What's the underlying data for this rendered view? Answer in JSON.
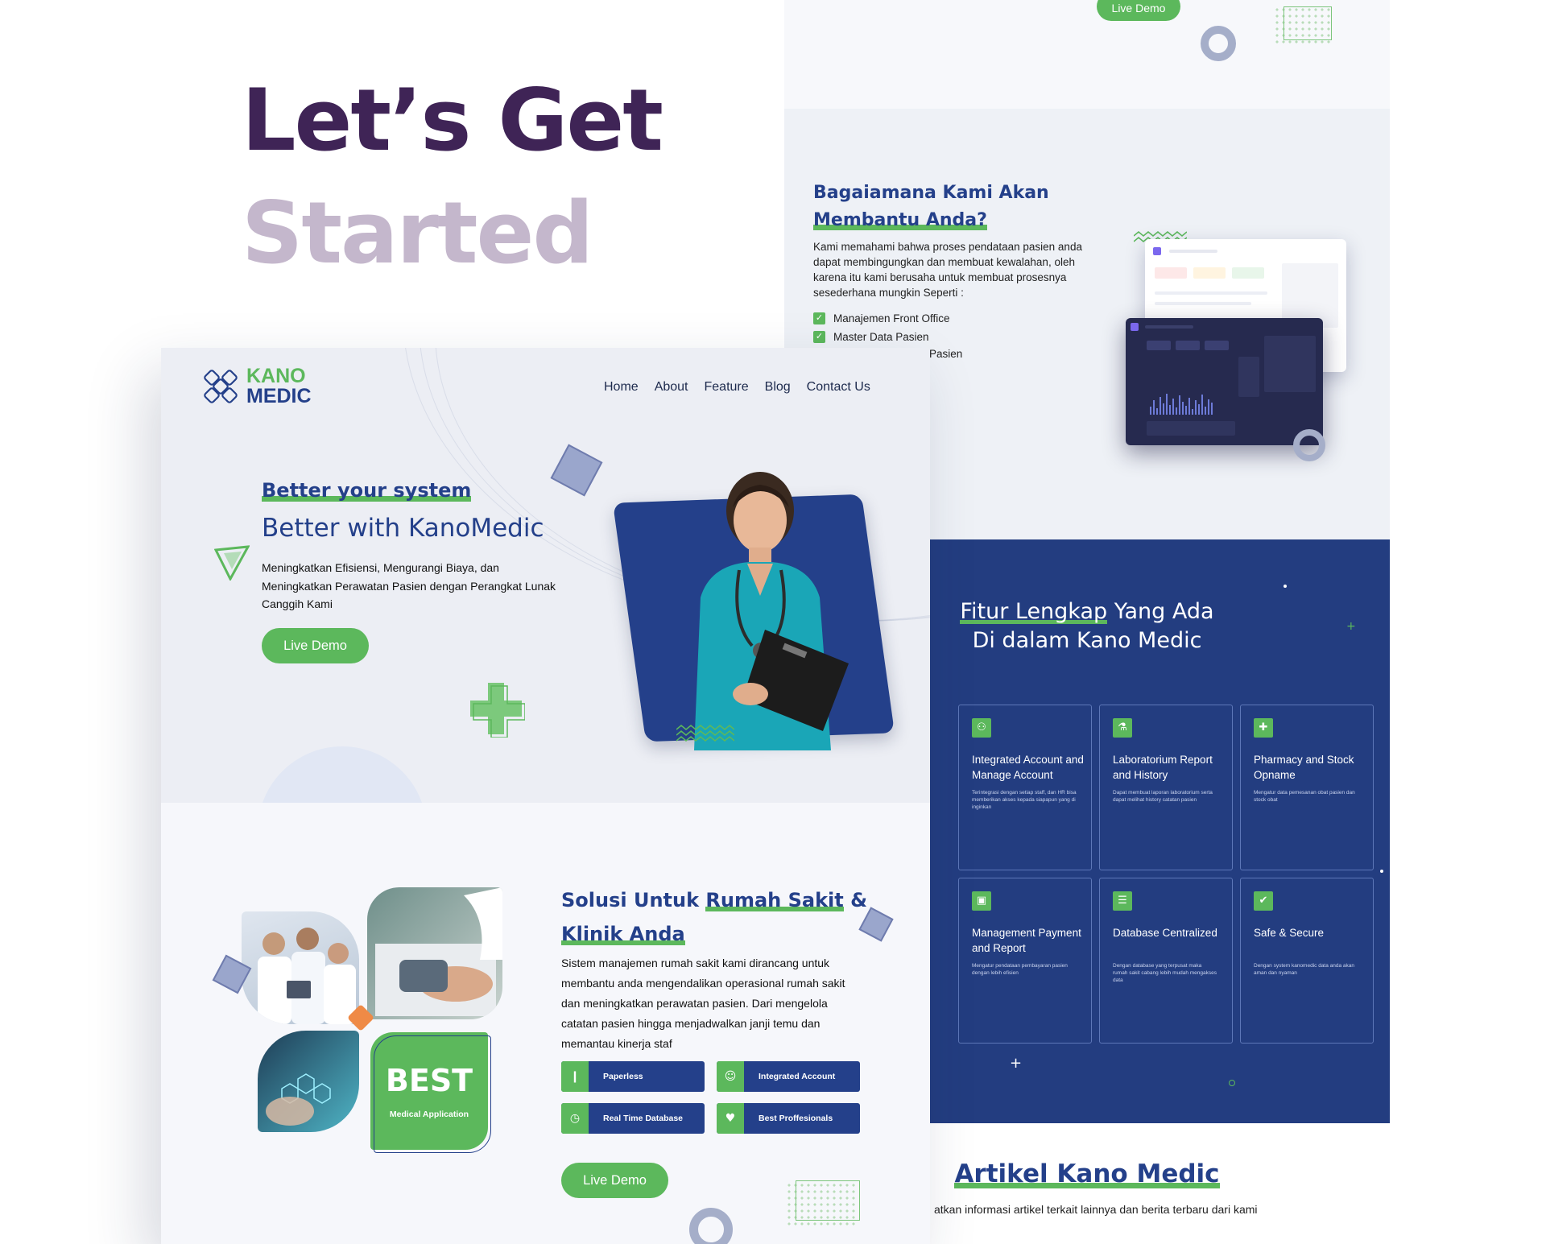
{
  "showcase": {
    "headline_line1": "Let’s Get",
    "headline_line2": "Started"
  },
  "right_page": {
    "top": {
      "live_demo_label": "Live Demo"
    },
    "how": {
      "title_line1": "Bagaiamana Kami Akan",
      "title_line2": "Membantu Anda?",
      "body": "Kami memahami bahwa proses pendataan pasien anda dapat membingungkan dan membuat kewalahan, oleh karena itu kami berusaha untuk membuat prosesnya sesederhana  mungkin Seperti :",
      "checklist": [
        "Manajemen Front Office",
        "Master Data Pasien",
        "Pasien"
      ]
    },
    "features": {
      "title_highlight": "Fitur Lengkap",
      "title_rest": " Yang Ada",
      "title_line2": "Di dalam Kano Medic",
      "cards": [
        {
          "icon": "users-network-icon",
          "glyph": "⚇",
          "title": "Integrated Account and Manage Account",
          "desc": "Terintegrasi dengan setiap staff, dan HR bisa memberikan akses kepada siapapun yang di inginkan"
        },
        {
          "icon": "flask-icon",
          "glyph": "⚗",
          "title": "Laboratorium Report and History",
          "desc": "Dapat membuat laporan laboratorium serta dapat melihat history catatan pasien"
        },
        {
          "icon": "pharmacy-icon",
          "glyph": "✚",
          "title": "Pharmacy and Stock Opname",
          "desc": "Mengatur data pemesanan obat pasien dan stock obat"
        },
        {
          "icon": "money-icon",
          "glyph": "▣",
          "title": "Management Payment and Report",
          "desc": "Mengatur pendataan pembayaran pasien dengan lebih efisien"
        },
        {
          "icon": "database-list-icon",
          "glyph": "☰",
          "title": "Database Centralized",
          "desc": "Dengan database yang terpusat maka rumah sakit cabang lebih mudah mengakses data"
        },
        {
          "icon": "shield-check-icon",
          "glyph": "✔",
          "title": "Safe & Secure",
          "desc": "Dengan system kanomedic data anda akan aman dan nyaman"
        }
      ]
    },
    "articles": {
      "title": "Artikel Kano Medic",
      "subtitle": "atkan informasi artikel terkait lainnya dan berita terbaru dari kami"
    }
  },
  "left_page": {
    "brand": {
      "line1": "KANO",
      "line2": "MEDIC"
    },
    "nav": [
      "Home",
      "About",
      "Feature",
      "Blog",
      "Contact Us"
    ],
    "hero": {
      "kicker": "Better your system",
      "title": "Better with KanoMedic",
      "description": "Meningkatkan Efisiensi, Mengurangi Biaya, dan Meningkatkan Perawatan Pasien dengan Perangkat Lunak Canggih Kami",
      "cta": "Live Demo"
    },
    "solution": {
      "title_plain": "Solusi Untuk ",
      "title_highlight": "Rumah Sakit",
      "title_amp": " &",
      "title_line2": "Klinik Anda",
      "body": "Sistem manajemen rumah sakit kami  dirancang untuk membantu anda mengendalikan operasional rumah sakit dan meningkatkan perawatan pasien. Dari mengelola catatan pasien hingga menjadwalkan janji temu dan memantau kinerja staf",
      "pills": [
        {
          "icon": "document-icon",
          "glyph": "❙",
          "label": "Paperless"
        },
        {
          "icon": "users-icon",
          "glyph": "☺",
          "label": "Integrated Account"
        },
        {
          "icon": "clock-icon",
          "glyph": "◷",
          "label": "Real Time Database"
        },
        {
          "icon": "hand-heart-icon",
          "glyph": "♥",
          "label": "Best Proffesionals"
        }
      ],
      "cta": "Live Demo",
      "badge_big": "BEST",
      "badge_small": "Medical Application"
    }
  },
  "colors": {
    "brand_blue": "#24408a",
    "brand_green": "#5cb85c",
    "headline_purple": "#3f2456",
    "headline_faded": "#c4b7cc",
    "accent_orange": "#ef8a46"
  }
}
